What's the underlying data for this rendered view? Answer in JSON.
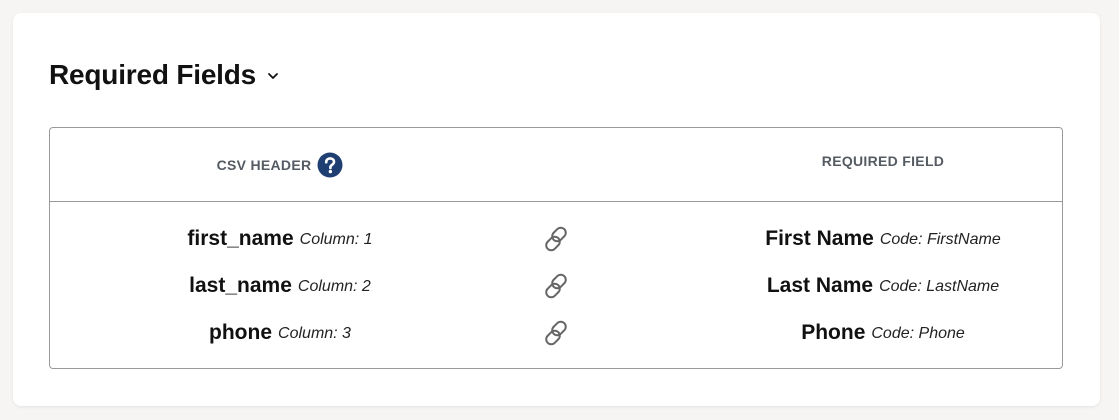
{
  "section": {
    "title": "Required Fields",
    "toggle_icon": "chevron-down-icon"
  },
  "table": {
    "csv_header_label": "CSV HEADER",
    "help_icon": "question-circle-icon",
    "required_field_label": "REQUIRED FIELD",
    "link_icon": "link-icon",
    "rows": [
      {
        "csv_name": "first_name",
        "column": "Column: 1",
        "field_name": "First Name",
        "code": "Code: FirstName"
      },
      {
        "csv_name": "last_name",
        "column": "Column: 2",
        "field_name": "Last Name",
        "code": "Code: LastName"
      },
      {
        "csv_name": "phone",
        "column": "Column: 3",
        "field_name": "Phone",
        "code": "Code: Phone"
      }
    ]
  },
  "colors": {
    "page_background": "#f6f5f3",
    "card_background": "#ffffff",
    "border": "#9a9a9a",
    "help_icon": "#1f3f73",
    "header_text": "#555b63",
    "link_icon": "#666666"
  }
}
